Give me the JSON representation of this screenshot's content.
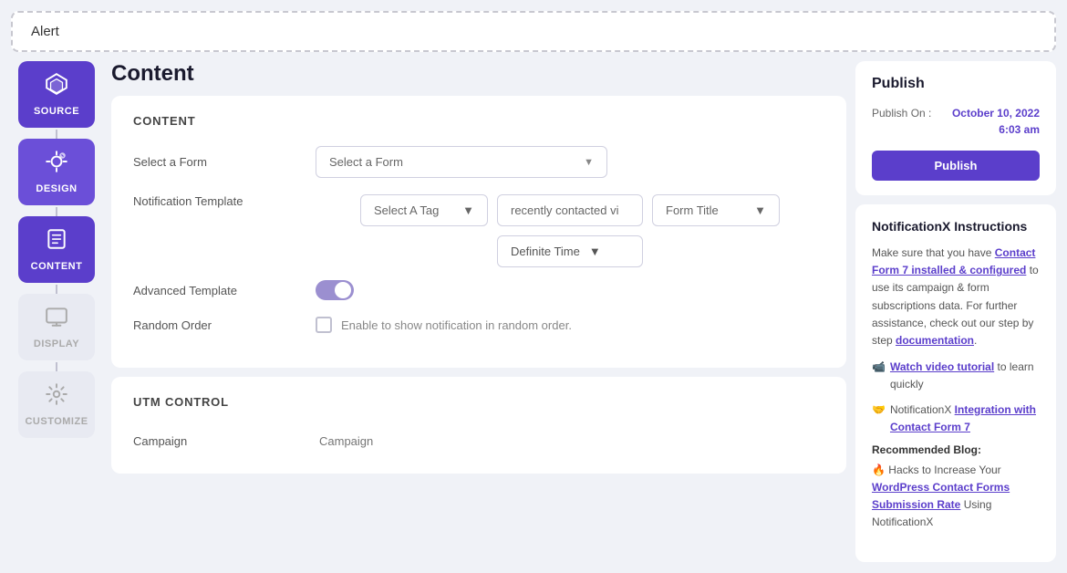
{
  "alert": {
    "text": "Alert"
  },
  "sidebar": {
    "items": [
      {
        "id": "source",
        "label": "SOURCE",
        "icon": "⬡",
        "state": "active"
      },
      {
        "id": "design",
        "label": "DESIGN",
        "icon": "✎",
        "state": "active-light"
      },
      {
        "id": "content",
        "label": "CONTENT",
        "icon": "☰",
        "state": "active"
      },
      {
        "id": "display",
        "label": "DISPLAY",
        "icon": "⬜",
        "state": "inactive"
      },
      {
        "id": "customize",
        "label": "CUSTOMIZE",
        "icon": "⚙",
        "state": "inactive"
      }
    ]
  },
  "page": {
    "title": "Content"
  },
  "content_section": {
    "title": "CONTENT",
    "select_form_label": "Select a Form",
    "select_form_placeholder": "Select a Form",
    "notification_template_label": "Notification Template",
    "tag_placeholder": "Select A Tag",
    "recently_contacted": "recently contacted vi",
    "form_title": "Form Title",
    "definite_time": "Definite Time",
    "advanced_template_label": "Advanced Template",
    "random_order_label": "Random Order",
    "random_order_help": "Enable to show notification in random order."
  },
  "utm_section": {
    "title": "UTM CONTROL",
    "campaign_label": "Campaign",
    "campaign_placeholder": "Campaign"
  },
  "publish": {
    "title": "Publish",
    "publish_on_label": "Publish On :",
    "publish_date": "October 10, 2022\n6:03 am",
    "publish_button": "Publish"
  },
  "instructions": {
    "title": "NotificationX Instructions",
    "intro": "Make sure that you have ",
    "link1": "Contact Form 7 installed & configured",
    "mid_text": " to use its campaign & form subscriptions data. For further assistance, check out our step by step ",
    "link2": "documentation",
    "video_item_pre": "",
    "video_link": "Watch video tutorial",
    "video_post": " to learn quickly",
    "integration_pre": "NotificationX ",
    "integration_link": "Integration with Contact Form 7",
    "recommended_label": "Recommended Blog:",
    "blog_pre": "🔥 Hacks to Increase Your ",
    "blog_link": "WordPress Contact Forms Submission Rate",
    "blog_post": " Using NotificationX"
  }
}
